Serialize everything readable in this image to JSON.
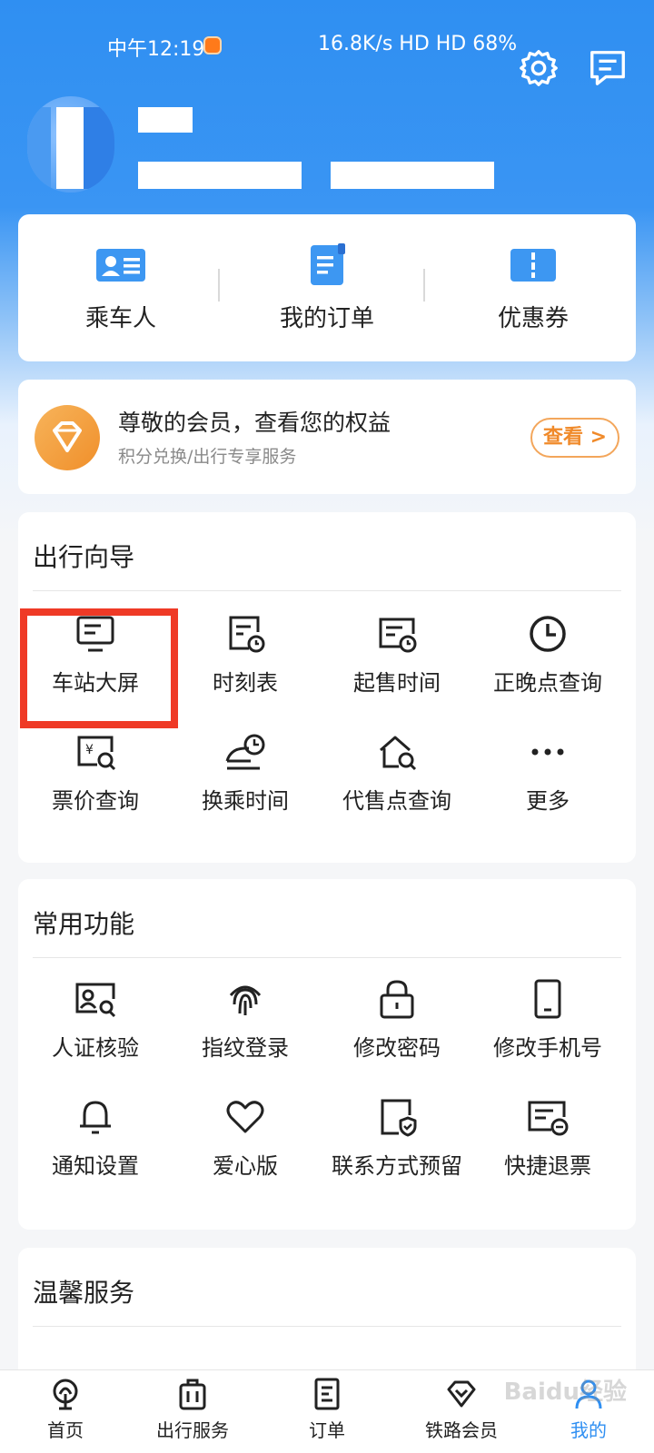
{
  "status_bar": {
    "time": "中午12:19",
    "right": "16.8K/s  HD HD  68%"
  },
  "quick_links": [
    {
      "label": "乘车人",
      "icon": "id-card-icon"
    },
    {
      "label": "我的订单",
      "icon": "order-document-icon"
    },
    {
      "label": "优惠券",
      "icon": "coupon-icon"
    }
  ],
  "member": {
    "title": "尊敬的会员，查看您的权益",
    "subtitle": "积分兑换/出行专享服务",
    "button": "查看 >"
  },
  "travel_guide": {
    "title": "出行向导",
    "items": [
      {
        "label": "车站大屏",
        "icon": "station-screen-icon"
      },
      {
        "label": "时刻表",
        "icon": "timetable-icon"
      },
      {
        "label": "起售时间",
        "icon": "sale-time-icon"
      },
      {
        "label": "正晚点查询",
        "icon": "clock-icon"
      },
      {
        "label": "票价查询",
        "icon": "fare-search-icon"
      },
      {
        "label": "换乘时间",
        "icon": "transfer-time-icon"
      },
      {
        "label": "代售点查询",
        "icon": "agency-search-icon"
      },
      {
        "label": "更多",
        "icon": "more-dots-icon"
      }
    ]
  },
  "common_functions": {
    "title": "常用功能",
    "items": [
      {
        "label": "人证核验",
        "icon": "id-verify-icon"
      },
      {
        "label": "指纹登录",
        "icon": "fingerprint-icon"
      },
      {
        "label": "修改密码",
        "icon": "lock-icon"
      },
      {
        "label": "修改手机号",
        "icon": "phone-icon"
      },
      {
        "label": "通知设置",
        "icon": "bell-icon"
      },
      {
        "label": "爱心版",
        "icon": "heart-icon"
      },
      {
        "label": "联系方式预留",
        "icon": "contact-shield-icon"
      },
      {
        "label": "快捷退票",
        "icon": "refund-ticket-icon"
      }
    ]
  },
  "warm_service": {
    "title": "温馨服务"
  },
  "tabbar": [
    {
      "label": "首页",
      "icon": "railway-logo-icon"
    },
    {
      "label": "出行服务",
      "icon": "luggage-icon"
    },
    {
      "label": "订单",
      "icon": "order-icon"
    },
    {
      "label": "铁路会员",
      "icon": "diamond-icon"
    },
    {
      "label": "我的",
      "icon": "user-icon"
    }
  ],
  "watermark": "Baidu经验",
  "colors": {
    "brand_blue": "#2f8ff2",
    "highlight_red": "#ef3a26",
    "member_orange": "#f08a2a"
  }
}
